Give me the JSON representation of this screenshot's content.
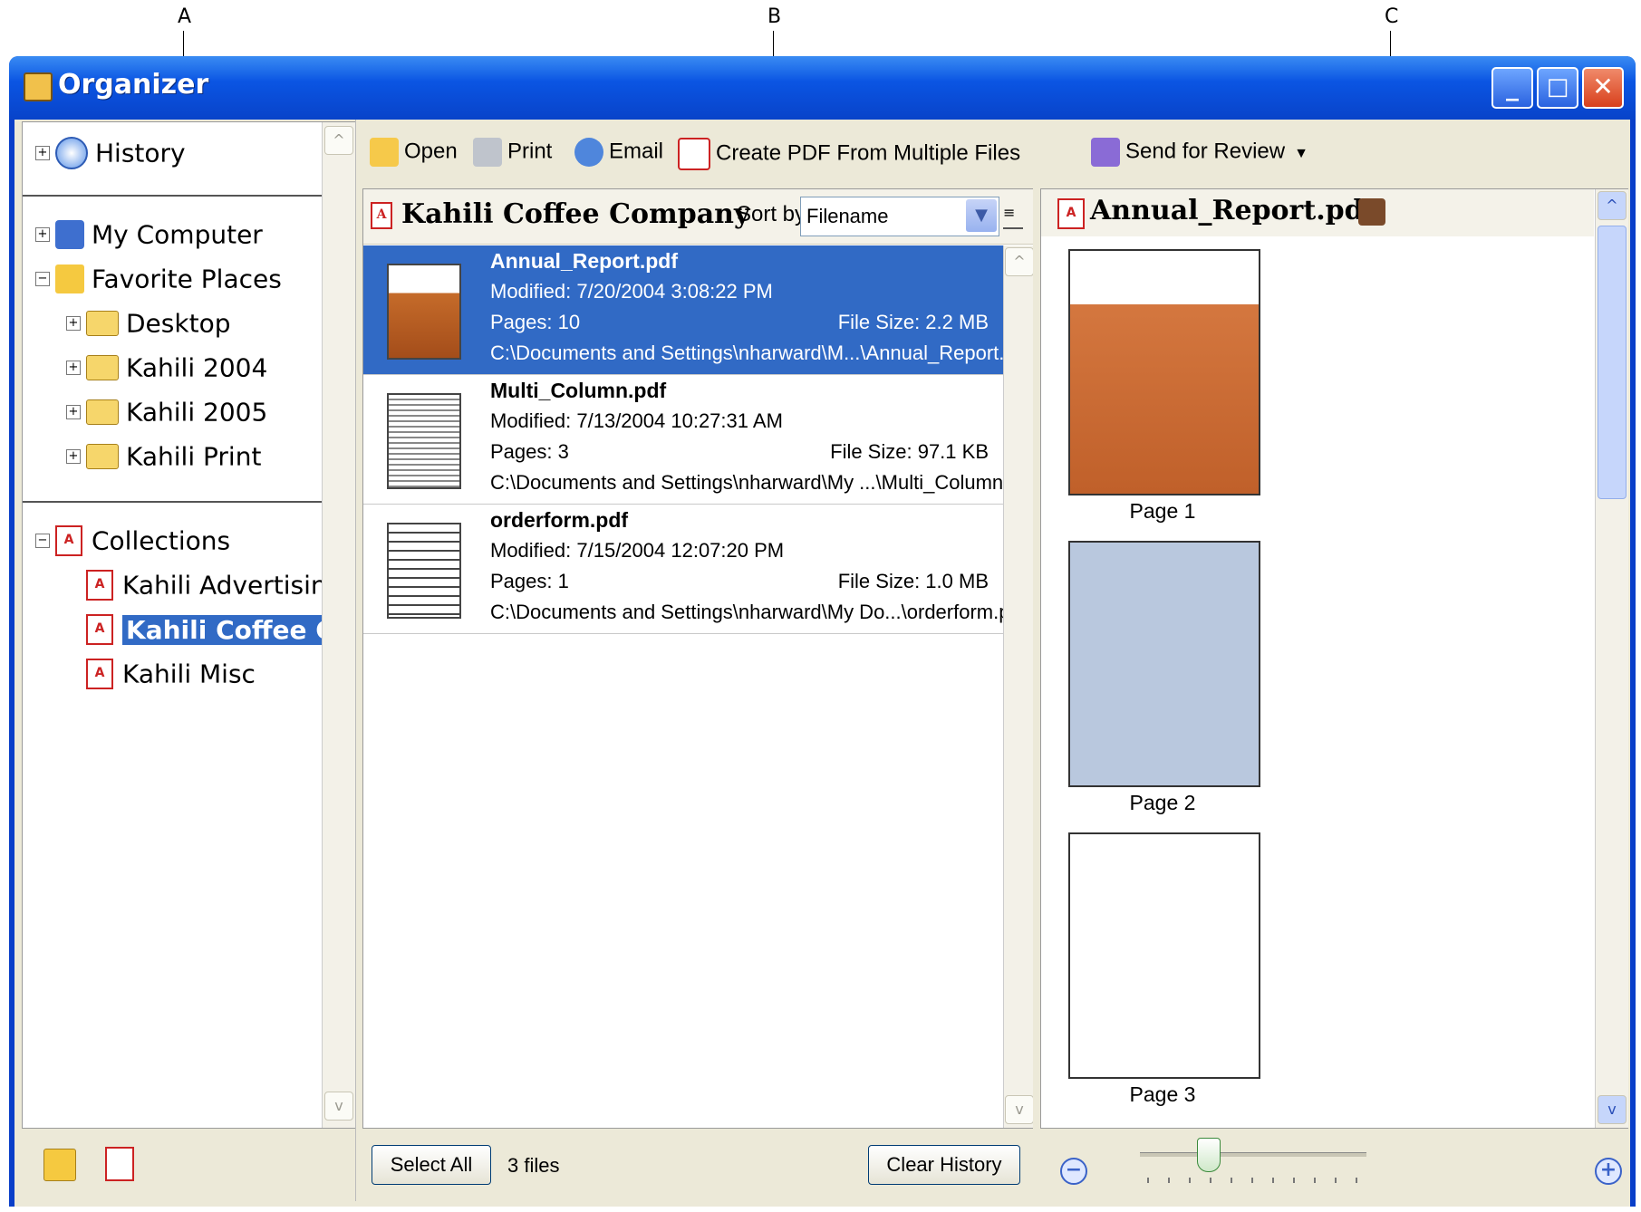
{
  "callouts": {
    "a": "A",
    "b": "B",
    "c": "C"
  },
  "window": {
    "title": "Organizer",
    "min": "_",
    "max": "□",
    "close": "✕"
  },
  "left": {
    "history": "History",
    "my_computer": "My Computer",
    "favorite_places": "Favorite Places",
    "folders": [
      "Desktop",
      "Kahili 2004",
      "Kahili 2005",
      "Kahili Print"
    ],
    "collections": "Collections",
    "collection_items": [
      "Kahili Advertising",
      "Kahili Coffee Co",
      "Kahili Misc"
    ]
  },
  "toolbar": {
    "open": "Open",
    "print": "Print",
    "email": "Email",
    "create_pdf": "Create PDF From Multiple Files",
    "send_review": "Send for Review"
  },
  "middle": {
    "title": "Kahili Coffee Company",
    "sort_label": "Sort by",
    "sort_value": "Filename",
    "files": [
      {
        "name": "Annual_Report.pdf",
        "modified": "Modified: 7/20/2004 3:08:22 PM",
        "pages": "Pages: 10",
        "size": "File Size: 2.2 MB",
        "path": "C:\\Documents and Settings\\nharward\\M...\\Annual_Report.pdf"
      },
      {
        "name": "Multi_Column.pdf",
        "modified": "Modified: 7/13/2004 10:27:31 AM",
        "pages": "Pages: 3",
        "size": "File Size: 97.1 KB",
        "path": "C:\\Documents and Settings\\nharward\\My ...\\Multi_Column.pdf"
      },
      {
        "name": "orderform.pdf",
        "modified": "Modified: 7/15/2004 12:07:20 PM",
        "pages": "Pages: 1",
        "size": "File Size: 1.0 MB",
        "path": "C:\\Documents and Settings\\nharward\\My Do...\\orderform.pdf"
      }
    ],
    "select_all": "Select All",
    "count": "3 files",
    "clear_history": "Clear History"
  },
  "right": {
    "title": "Annual_Report.pdf",
    "pages": [
      "Page 1",
      "Page 2",
      "Page 3"
    ],
    "zoom_level": 0.3
  },
  "colors": {
    "selection": "#316ac5",
    "titlebar": "#0b55e3"
  }
}
